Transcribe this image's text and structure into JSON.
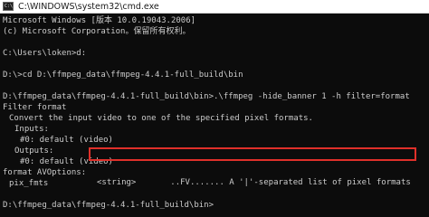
{
  "window": {
    "icon_text": "C:\\",
    "title": "C:\\WINDOWS\\system32\\cmd.exe"
  },
  "console": {
    "lines": [
      "Microsoft Windows [版本 10.0.19043.2006]",
      "(c) Microsoft Corporation。保留所有权利。",
      "",
      "C:\\Users\\loken>d:",
      "",
      "D:\\>cd D:\\ffmpeg_data\\ffmpeg-4.4.1-full_build\\bin",
      "",
      "D:\\ffmpeg_data\\ffmpeg-4.4.1-full_build\\bin>.\\ffmpeg -hide_banner 1 -h filter=format",
      "Filter format",
      "Convert the input video to one of the specified pixel formats.",
      "Inputs:",
      "#0: default (video)",
      "Outputs:",
      "#0: default (video)",
      "format AVOptions:",
      "pix_fmts",
      "<string>       ..FV....... A '|'-separated list of pixel formats",
      "",
      "D:\\ffmpeg_data\\ffmpeg-4.4.1-full_build\\bin>"
    ]
  },
  "colors": {
    "console_background": "#0c0c0c",
    "console_text": "#cccccc",
    "highlight_border": "#e0302a",
    "titlebar_background": "#ffffff"
  }
}
